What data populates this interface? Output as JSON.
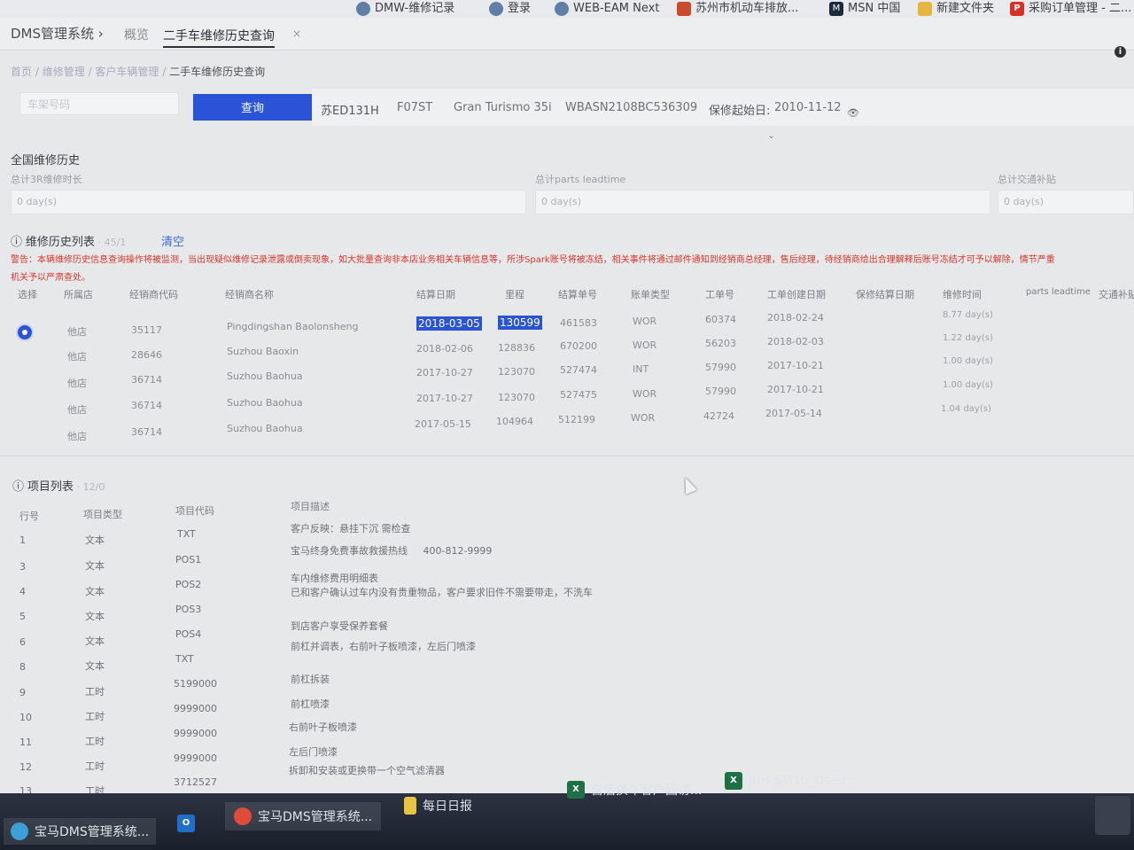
{
  "bookmarks": [
    {
      "label": "DMW-维修记录",
      "icon": "globe-icon"
    },
    {
      "label": "登录",
      "icon": "globe-icon"
    },
    {
      "label": "WEB-EAM Next",
      "icon": "globe-icon"
    },
    {
      "label": "苏州市机动车排放...",
      "icon": "car-icon"
    },
    {
      "label": "MSN 中国",
      "icon": "msn-icon"
    },
    {
      "label": "新建文件夹",
      "icon": "folder-icon"
    },
    {
      "label": "采购订单管理 - 二...",
      "icon": "p-icon"
    }
  ],
  "app": {
    "title": "DMS管理系统 ›",
    "tabs": [
      "概览",
      "二手车维修历史查询"
    ],
    "tab_close": "×"
  },
  "breadcrumb": {
    "parts": [
      "首页 /",
      "维修管理 /",
      "客户车辆管理 /"
    ],
    "current": "二手车维修历史查询"
  },
  "query": {
    "input_placeholder": "车架号码",
    "button": "查询",
    "plate": "苏ED131H",
    "model_code": "F07ST",
    "model_name": "Gran Turismo 35i",
    "vin": "WBASN2108BC536309",
    "warranty_label": "保修起始日:",
    "warranty_date": "2010-11-12"
  },
  "national": {
    "title": "全国维修历史",
    "stats": [
      {
        "label": "总计3R维修时长",
        "value": "0 day(s)"
      },
      {
        "label": "总计parts leadtime",
        "value": "0 day(s)"
      },
      {
        "label": "总计交通补贴",
        "value": "0 day(s)"
      }
    ]
  },
  "repair": {
    "title": "维修历史列表",
    "count": "· 45/1",
    "clear": "清空",
    "warning_line1": "警告：本辆维修历史信息查询操作将被监测，当出现疑似维修记录泄露或倒卖现象，如大批量查询非本店业务相关车辆信息等，所涉Spark账号将被冻结，相关事件将通过邮件通知到经销商总经理，售后经理，待经销商给出合理解释后账号冻结才可予以解除，情节严重",
    "warning_line2": "机关予以严肃查处。",
    "headers": [
      "选择",
      "所属店",
      "经销商代码",
      "经销商名称",
      "结算日期",
      "里程",
      "结算单号",
      "账单类型",
      "工单号",
      "工单创建日期",
      "保修结算日期",
      "维修时间",
      "parts leadtime",
      "交通补贴"
    ],
    "rows": [
      {
        "store": "他店",
        "code": "35117",
        "name": "Pingdingshan Baolonsheng",
        "date": "2018-03-05",
        "mileage": "130599",
        "bill": "461583",
        "type": "WOR",
        "wo": "60374",
        "wo_date": "2018-02-24",
        "time": "8.77 day(s)"
      },
      {
        "store": "他店",
        "code": "28646",
        "name": "Suzhou Baoxin",
        "date": "2018-02-06",
        "mileage": "128836",
        "bill": "670200",
        "type": "WOR",
        "wo": "56203",
        "wo_date": "2018-02-03",
        "time": "1.22 day(s)"
      },
      {
        "store": "他店",
        "code": "36714",
        "name": "Suzhou Baohua",
        "date": "2017-10-27",
        "mileage": "123070",
        "bill": "527474",
        "type": "INT",
        "wo": "57990",
        "wo_date": "2017-10-21",
        "time": "1.00 day(s)"
      },
      {
        "store": "他店",
        "code": "36714",
        "name": "Suzhou Baohua",
        "date": "2017-10-27",
        "mileage": "123070",
        "bill": "527475",
        "type": "WOR",
        "wo": "57990",
        "wo_date": "2017-10-21",
        "time": "1.00 day(s)"
      },
      {
        "store": "他店",
        "code": "36714",
        "name": "Suzhou Baohua",
        "date": "2017-05-15",
        "mileage": "104964",
        "bill": "512199",
        "type": "WOR",
        "wo": "42724",
        "wo_date": "2017-05-14",
        "time": "1.04 day(s)"
      }
    ]
  },
  "items": {
    "title": "项目列表",
    "count": "· 12/0",
    "headers": [
      "行号",
      "项目类型",
      "项目代码",
      "项目描述"
    ],
    "rows": [
      {
        "no": "1",
        "type": "文本",
        "code": "TXT",
        "desc": "客户反映：悬挂下沉  需检查"
      },
      {
        "no": "3",
        "type": "文本",
        "code": "POS1",
        "desc": "宝马终身免费事故救援热线     400-812-9999"
      },
      {
        "no": "4",
        "type": "文本",
        "code": "POS2",
        "desc": "车内维修费用明细表"
      },
      {
        "no": "5",
        "type": "文本",
        "code": "POS3",
        "desc": "已和客户确认过车内没有贵重物品，客户要求旧件不需要带走，不洗车"
      },
      {
        "no": "6",
        "type": "文本",
        "code": "POS4",
        "desc": "到店客户享受保养套餐"
      },
      {
        "no": "8",
        "type": "文本",
        "code": "TXT",
        "desc": "前杠并调表，右前叶子板喷漆，左后门喷漆"
      },
      {
        "no": "9",
        "type": "工时",
        "code": "5199000",
        "desc": "前杠拆装"
      },
      {
        "no": "10",
        "type": "工时",
        "code": "9999000",
        "desc": "前杠喷漆"
      },
      {
        "no": "11",
        "type": "工时",
        "code": "9999000",
        "desc": "右前叶子板喷漆"
      },
      {
        "no": "12",
        "type": "工时",
        "code": "9999000",
        "desc": "左后门喷漆"
      },
      {
        "no": "13",
        "type": "工时",
        "code": "3712527",
        "desc": "拆卸和安装或更换带一个空气滤清器"
      }
    ]
  },
  "taskbar": [
    {
      "label": "宝马DMS管理系统...",
      "icon": "chrome-icon"
    },
    {
      "label": "",
      "icon": "outlook-icon"
    },
    {
      "label": "宝马DMS管理系统...",
      "icon": "chrome-icon"
    },
    {
      "label": "每日日报",
      "icon": "notes-icon"
    },
    {
      "label": "售后换车客户回访...",
      "icon": "excel-icon"
    },
    {
      "label": "JBH SM1b_Used ...",
      "icon": "excel-icon"
    }
  ],
  "colors": {
    "accent": "#2a54d8",
    "warning": "#d9362b",
    "taskbar": "#1f2530"
  }
}
